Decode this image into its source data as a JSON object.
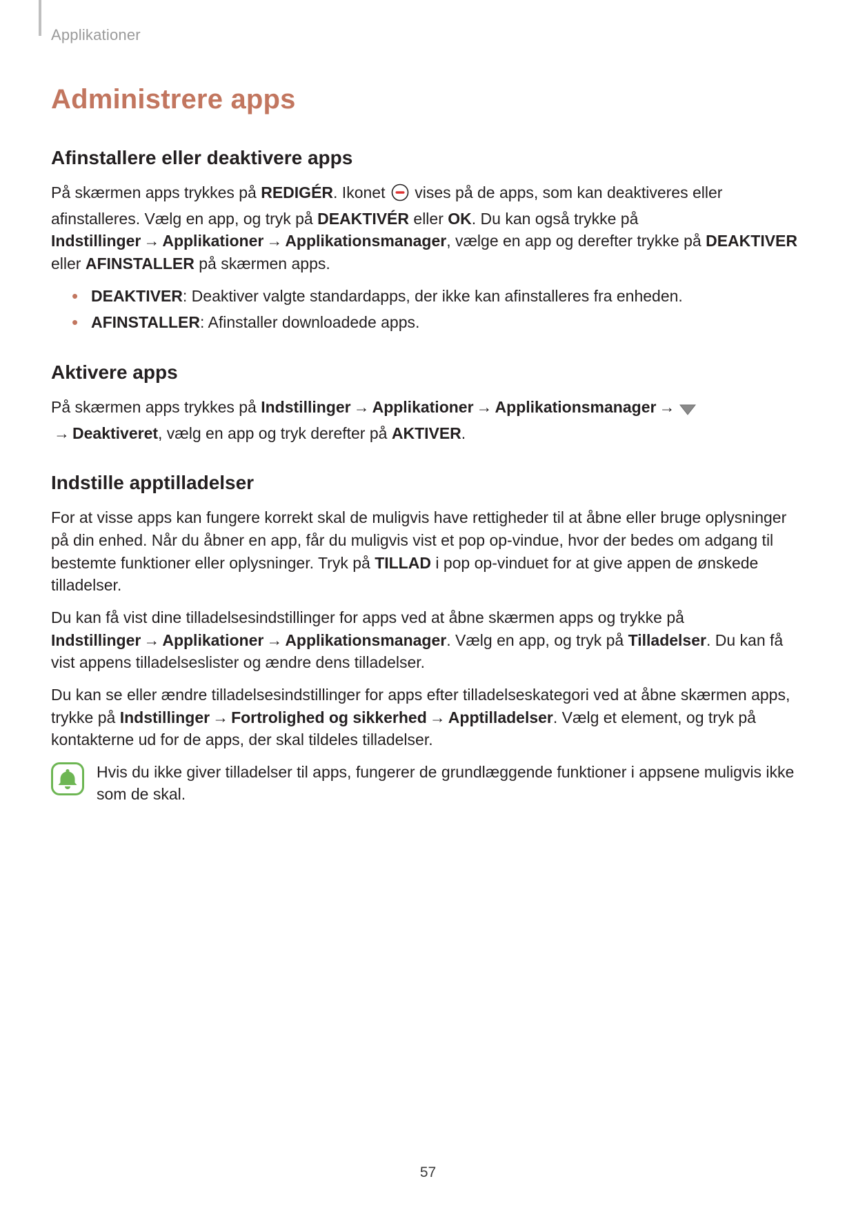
{
  "runningHead": "Applikationer",
  "title": "Administrere apps",
  "pageNumber": "57",
  "sec1": {
    "heading": "Afinstallere eller deaktivere apps",
    "p1a": "På skærmen apps trykkes på ",
    "p1b": "REDIGÉR",
    "p1c": ". Ikonet ",
    "p1d": " vises på de apps, som kan deaktiveres eller afinstalleres. Vælg en app, og tryk på ",
    "p1e": "DEAKTIVÉR",
    "p1f": " eller ",
    "p1g": "OK",
    "p1h": ". Du kan også trykke på ",
    "p1i": "Indstillinger",
    "p1j": "Applikationer",
    "p1k": "Applikationsmanager",
    "p1l": ", vælge en app og derefter trykke på ",
    "p1m": "DEAKTIVER",
    "p1n": " eller ",
    "p1o": "AFINSTALLER",
    "p1p": " på skærmen apps.",
    "bullet1a": "DEAKTIVER",
    "bullet1b": ": Deaktiver valgte standardapps, der ikke kan afinstalleres fra enheden.",
    "bullet2a": "AFINSTALLER",
    "bullet2b": ": Afinstaller downloadede apps."
  },
  "sec2": {
    "heading": "Aktivere apps",
    "p1a": "På skærmen apps trykkes på ",
    "p1b": "Indstillinger",
    "p1c": "Applikationer",
    "p1d": "Applikationsmanager",
    "p1e": "Deaktiveret",
    "p1f": ", vælg en app og tryk derefter på ",
    "p1g": "AKTIVER",
    "p1h": "."
  },
  "sec3": {
    "heading": "Indstille apptilladelser",
    "p1": "For at visse apps kan fungere korrekt skal de muligvis have rettigheder til at åbne eller bruge oplysninger på din enhed. Når du åbner en app, får du muligvis vist et pop op-vindue, hvor der bedes om adgang til bestemte funktioner eller oplysninger. Tryk på ",
    "p1b": "TILLAD",
    "p1c": " i pop op-vinduet for at give appen de ønskede tilladelser.",
    "p2a": "Du kan få vist dine tilladelsesindstillinger for apps ved at åbne skærmen apps og trykke på ",
    "p2b": "Indstillinger",
    "p2c": "Applikationer",
    "p2d": "Applikationsmanager",
    "p2e": ". Vælg en app, og tryk på ",
    "p2f": "Tilladelser",
    "p2g": ". Du kan få vist appens tilladelseslister og ændre dens tilladelser.",
    "p3a": "Du kan se eller ændre tilladelsesindstillinger for apps efter tilladelseskategori ved at åbne skærmen apps, trykke på ",
    "p3b": "Indstillinger",
    "p3c": "Fortrolighed og sikkerhed",
    "p3d": "Apptilladelser",
    "p3e": ". Vælg et element, og tryk på kontakterne ud for de apps, der skal tildeles tilladelser.",
    "note": "Hvis du ikke giver tilladelser til apps, fungerer de grundlæggende funktioner i appsene muligvis ikke som de skal."
  },
  "arrow": "→"
}
